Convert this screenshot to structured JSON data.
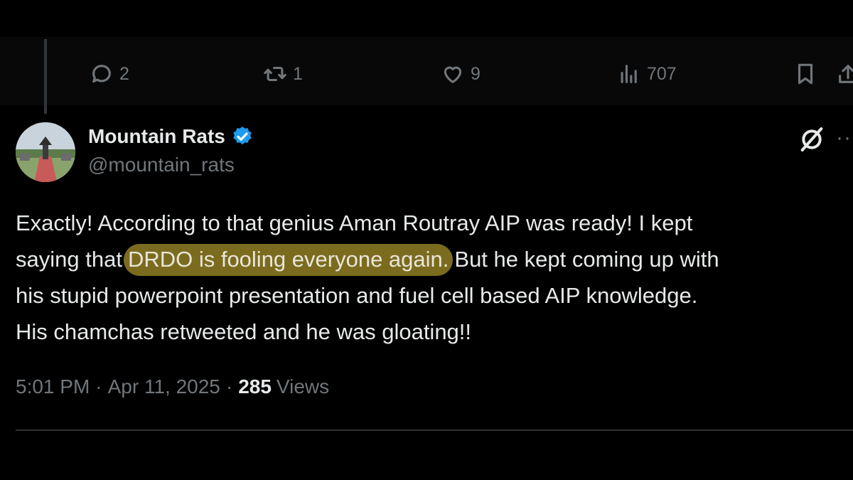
{
  "actions": {
    "reply_count": "2",
    "retweet_count": "1",
    "like_count": "9",
    "views_count": "707"
  },
  "author": {
    "display_name": "Mountain Rats",
    "handle": "@mountain_rats",
    "verified": true,
    "verified_color": "#1d9bf0"
  },
  "tweet": {
    "line1": "Exactly! According to that genius Aman Routray AIP was ready! I kept",
    "line2_before": "saying that",
    "line2_highlight": "DRDO is fooling everyone again.",
    "line2_after": "But he kept coming up with",
    "line3": "his stupid powerpoint presentation and fuel cell based AIP knowledge.",
    "line4": "His chamchas retweeted and he was gloating!!",
    "highlight_color": "#7b6b1f"
  },
  "meta": {
    "time": "5:01 PM",
    "separator": "·",
    "date": "Apr 11, 2025",
    "views_count": "285",
    "views_label": "Views"
  },
  "icons": {
    "reply": "speech-bubble-icon",
    "retweet": "retweet-icon",
    "like": "heart-icon",
    "views": "bar-chart-icon",
    "bookmark": "bookmark-icon",
    "share": "share-icon",
    "grok": "grok-icon",
    "more": "more-dots-icon"
  }
}
